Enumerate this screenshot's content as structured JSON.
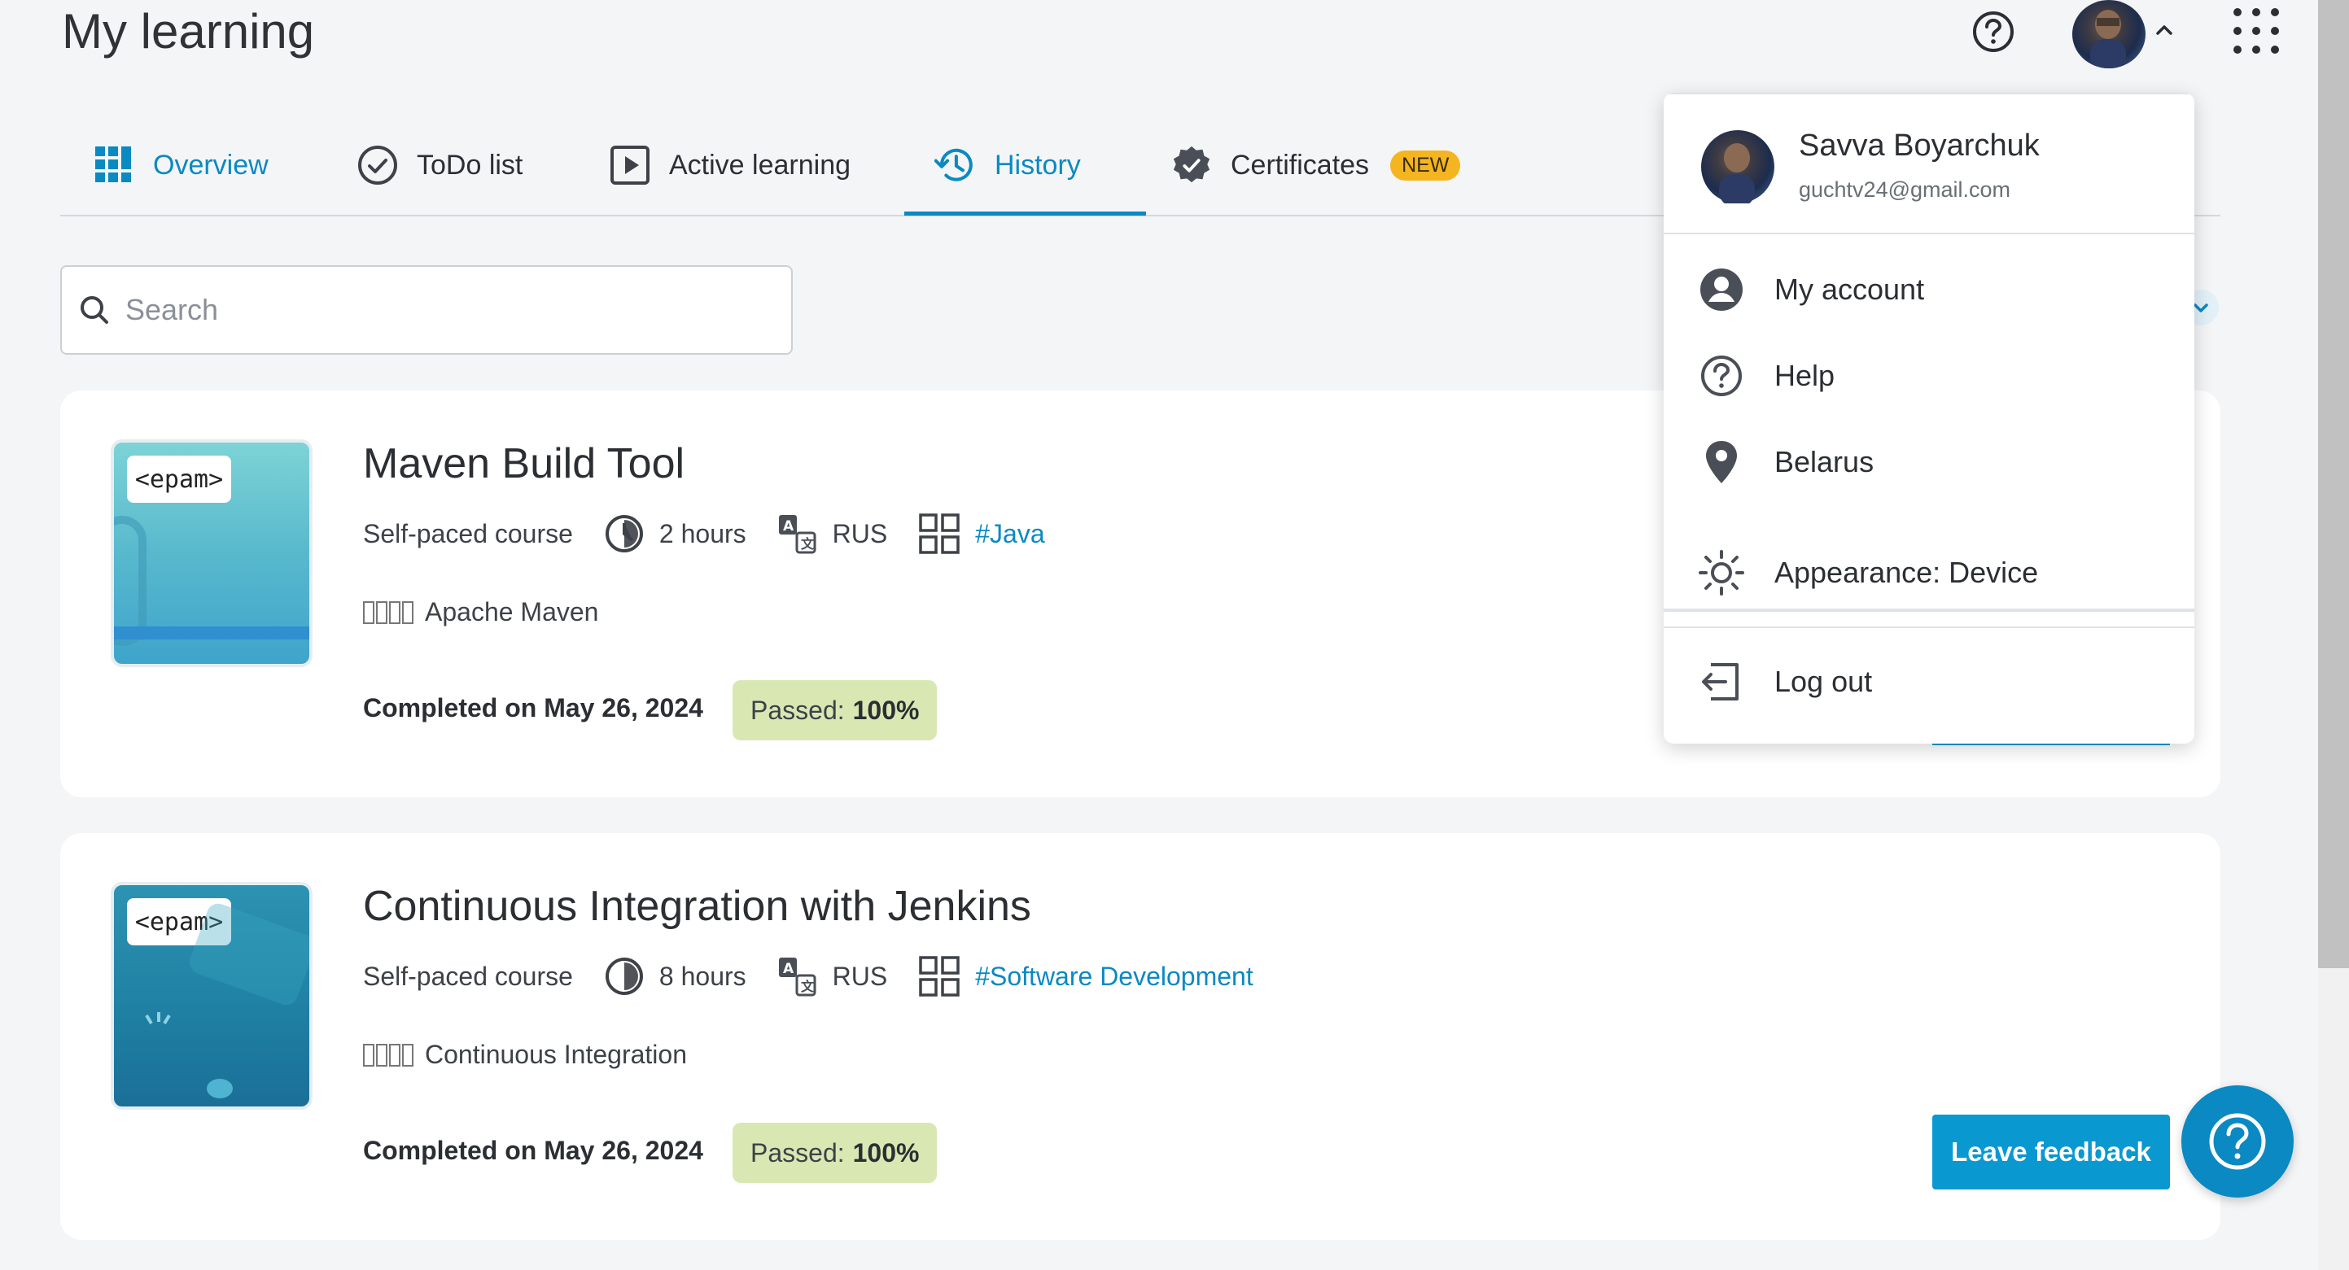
{
  "page": {
    "title": "My learning"
  },
  "tabs": [
    {
      "label": "Overview"
    },
    {
      "label": "ToDo list"
    },
    {
      "label": "Active learning"
    },
    {
      "label": "History"
    },
    {
      "label": "Certificates",
      "badge": "NEW"
    }
  ],
  "search": {
    "placeholder": "Search"
  },
  "courses": [
    {
      "logo": "<epam>",
      "title": "Maven Build Tool",
      "type": "Self-paced course",
      "duration": "2 hours",
      "language": "RUS",
      "tag": "#Java",
      "skill": "Apache Maven",
      "completed": "Completed on May 26, 2024",
      "passed_label": "Passed:",
      "passed_value": "100%"
    },
    {
      "logo": "<epam>",
      "title": "Continuous Integration with Jenkins",
      "type": "Self-paced course",
      "duration": "8 hours",
      "language": "RUS",
      "tag": "#Software Development",
      "skill": "Continuous Integration",
      "completed": "Completed on May 26, 2024",
      "passed_label": "Passed:",
      "passed_value": "100%"
    }
  ],
  "feedback": {
    "label": "Leave feedback"
  },
  "user_menu": {
    "name": "Savva Boyarchuk",
    "email": "guchtv24@gmail.com",
    "items": [
      {
        "label": "My account"
      },
      {
        "label": "Help"
      },
      {
        "label": "Belarus"
      },
      {
        "label": "Appearance: Device"
      },
      {
        "label": "Log out"
      }
    ]
  },
  "colors": {
    "accent": "#0a89c2",
    "badge": "#f4b521",
    "passed_bg": "#d9e8b3"
  }
}
